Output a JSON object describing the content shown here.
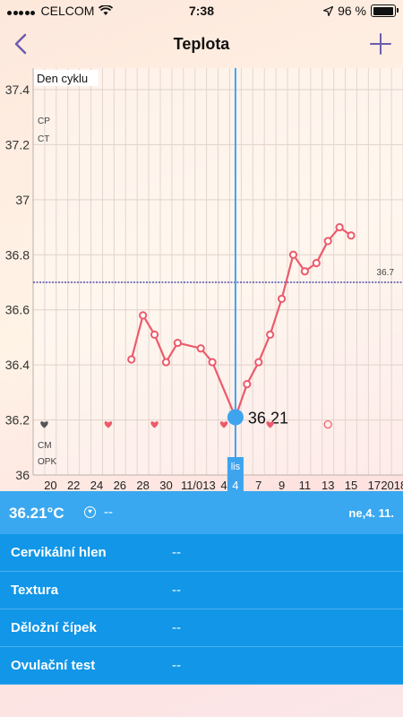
{
  "status": {
    "carrier": "CELCOM",
    "time": "7:38",
    "battery": "96 %"
  },
  "nav": {
    "title": "Teplota"
  },
  "chart_data": {
    "type": "line",
    "title": "",
    "xlabel": "Den cyklu",
    "ylim": [
      36,
      37.4
    ],
    "y_ticks": [
      "37.4",
      "37.2",
      "37",
      "36.8",
      "36.6",
      "36.4",
      "36.2",
      "36"
    ],
    "x_tick_labels": [
      "20",
      "22",
      "24",
      "26",
      "28",
      "30",
      "11/01",
      "3",
      "4",
      "5",
      "7",
      "9",
      "11",
      "13",
      "15",
      "17",
      "2018"
    ],
    "row_labels": [
      "CP",
      "CT",
      "CM",
      "OPK"
    ],
    "coverline": {
      "value": 36.7,
      "label": "36.7"
    },
    "selected": {
      "label": "36.21",
      "day_label": "lis",
      "day": "4"
    },
    "series": [
      {
        "values": [
          {
            "x": 27,
            "y": 36.42
          },
          {
            "x": 28,
            "y": 36.58
          },
          {
            "x": 29,
            "y": 36.51
          },
          {
            "x": 30,
            "y": 36.41
          },
          {
            "x": 31,
            "y": 36.48
          },
          {
            "x": 1,
            "y": 36.46
          },
          {
            "x": 2,
            "y": 36.41
          },
          {
            "x": 4,
            "y": 36.21
          },
          {
            "x": 5,
            "y": 36.33
          },
          {
            "x": 6,
            "y": 36.41
          },
          {
            "x": 7,
            "y": 36.51
          },
          {
            "x": 8,
            "y": 36.64
          },
          {
            "x": 9,
            "y": 36.8
          },
          {
            "x": 10,
            "y": 36.74
          },
          {
            "x": 11,
            "y": 36.77
          },
          {
            "x": 12,
            "y": 36.85
          },
          {
            "x": 13,
            "y": 36.9
          },
          {
            "x": 14,
            "y": 36.87
          }
        ]
      }
    ],
    "markers": [
      {
        "x": 19,
        "icon": "heart-icon-outline"
      },
      {
        "x": 25,
        "icon": "heart-icon"
      },
      {
        "x": 29,
        "icon": "heart-icon"
      },
      {
        "x": 3,
        "icon": "heart-icon"
      },
      {
        "x": 7,
        "icon": "heart-icon"
      },
      {
        "x": 12,
        "icon": "heart-outline-icon"
      }
    ],
    "colors": {
      "line": "#ec5b6b",
      "selected": "#3ea4ee",
      "coverline": "#2b2ea0"
    }
  },
  "panel": {
    "temperature": "36.21°C",
    "note": "--",
    "date": "ne,4. 11.",
    "rows": [
      {
        "label": "Cervikální hlen",
        "value": "--"
      },
      {
        "label": "Textura",
        "value": "--"
      },
      {
        "label": "Děložní čípek",
        "value": "--"
      },
      {
        "label": "Ovulační test",
        "value": "--"
      }
    ]
  }
}
